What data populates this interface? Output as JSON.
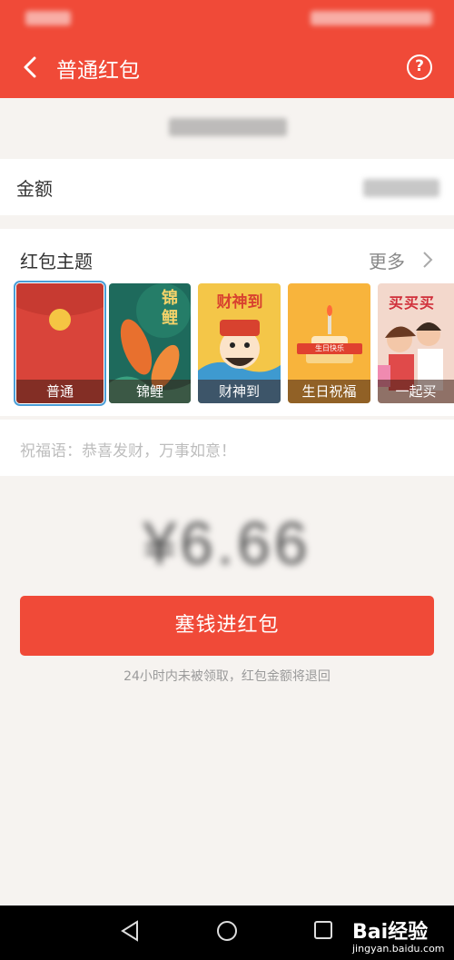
{
  "nav": {
    "title": "普通红包",
    "help_symbol": "?"
  },
  "amount": {
    "label": "金额"
  },
  "themes": {
    "title": "红包主题",
    "more": "更多",
    "items": [
      {
        "label": "普通",
        "art_text": ""
      },
      {
        "label": "锦鲤",
        "art_text": "锦鲤"
      },
      {
        "label": "财神到",
        "art_text": "财神到"
      },
      {
        "label": "生日祝福",
        "art_text": "生日快乐"
      },
      {
        "label": "一起买",
        "art_text": "买买买"
      }
    ],
    "selected_index": 0
  },
  "blessing": {
    "placeholder": "祝福语：恭喜发财，万事如意！"
  },
  "total": {
    "display": "¥6.66"
  },
  "submit": {
    "label": "塞钱进红包"
  },
  "note": {
    "text": "24小时内未被领取，红包金额将退回"
  },
  "watermark": {
    "brand": "Bai经验",
    "url": "jingyan.baidu.com"
  },
  "colors": {
    "accent": "#f04a38",
    "selected_outline": "#4a9ed6"
  }
}
